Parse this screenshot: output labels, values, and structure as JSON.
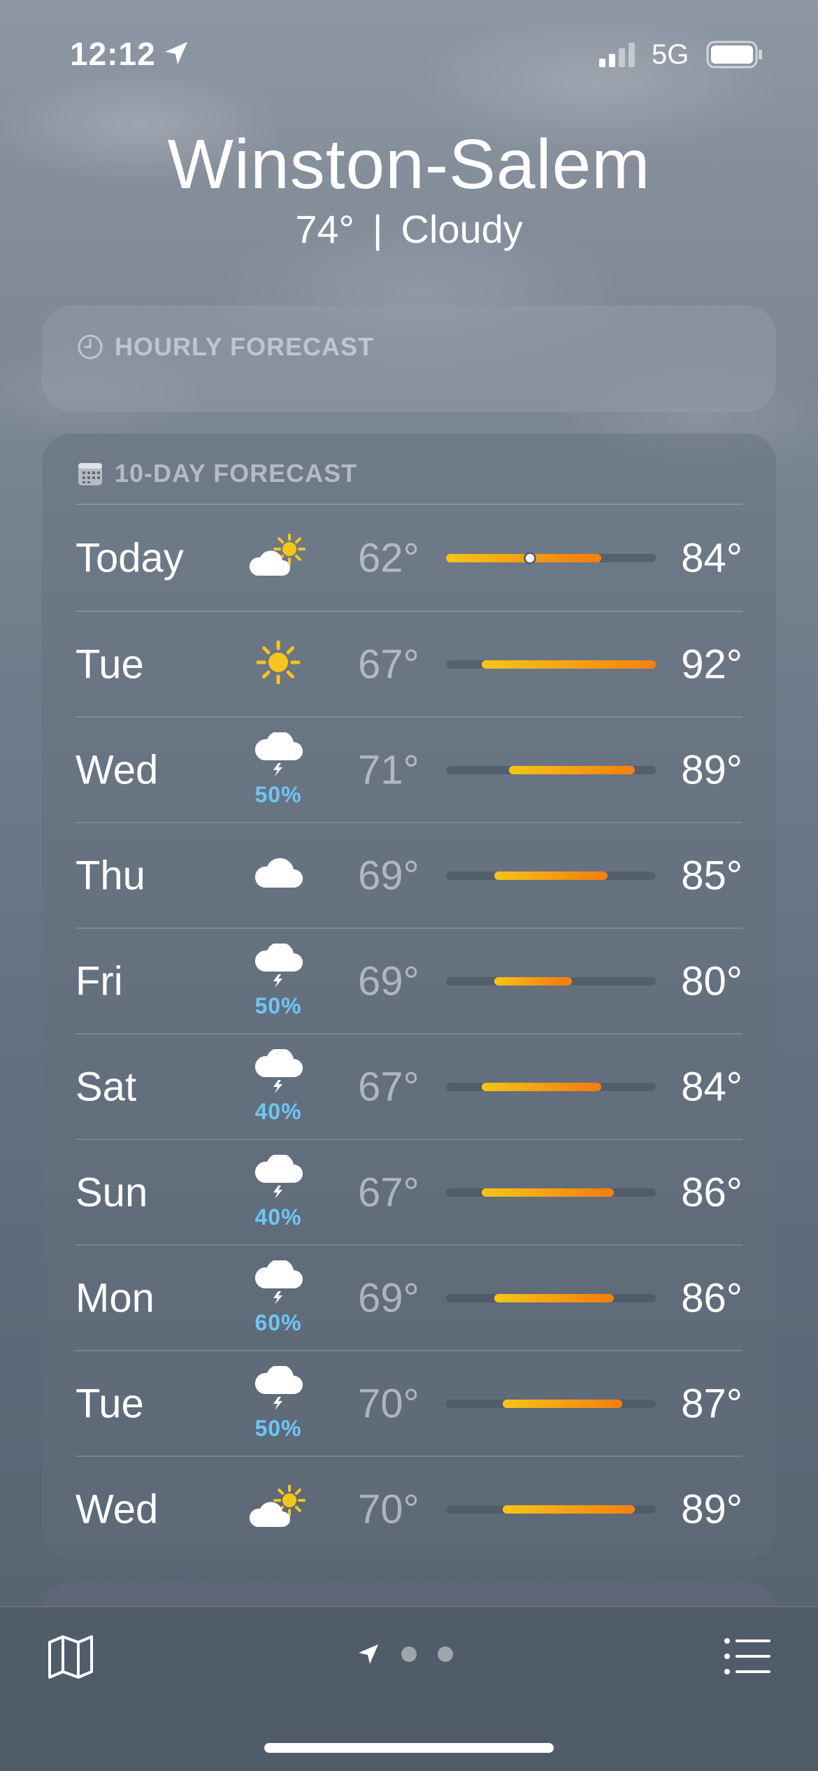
{
  "status_bar": {
    "time": "12:12",
    "network": "5G",
    "icons": [
      "location-arrow-icon",
      "signal-icon",
      "battery-icon"
    ]
  },
  "header": {
    "city": "Winston-Salem",
    "temperature": "74°",
    "separator": "|",
    "condition": "Cloudy"
  },
  "hourly": {
    "title": "HOURLY FORECAST",
    "icon": "clock-icon"
  },
  "ten_day": {
    "title": "10-DAY FORECAST",
    "icon": "calendar-icon",
    "days": [
      {
        "day": "Today",
        "icon": "partly-sunny-icon",
        "precip": "",
        "low": "62°",
        "high": "84°",
        "range_start": 0.0,
        "range_end": 0.74,
        "current": 0.4
      },
      {
        "day": "Tue",
        "icon": "sun-icon",
        "precip": "",
        "low": "67°",
        "high": "92°",
        "range_start": 0.17,
        "range_end": 1.0
      },
      {
        "day": "Wed",
        "icon": "thunderstorm-icon",
        "precip": "50%",
        "low": "71°",
        "high": "89°",
        "range_start": 0.3,
        "range_end": 0.9
      },
      {
        "day": "Thu",
        "icon": "cloud-icon",
        "precip": "",
        "low": "69°",
        "high": "85°",
        "range_start": 0.23,
        "range_end": 0.77
      },
      {
        "day": "Fri",
        "icon": "thunderstorm-icon",
        "precip": "50%",
        "low": "69°",
        "high": "80°",
        "range_start": 0.23,
        "range_end": 0.6
      },
      {
        "day": "Sat",
        "icon": "thunderstorm-icon",
        "precip": "40%",
        "low": "67°",
        "high": "84°",
        "range_start": 0.17,
        "range_end": 0.74
      },
      {
        "day": "Sun",
        "icon": "thunderstorm-icon",
        "precip": "40%",
        "low": "67°",
        "high": "86°",
        "range_start": 0.17,
        "range_end": 0.8
      },
      {
        "day": "Mon",
        "icon": "thunderstorm-icon",
        "precip": "60%",
        "low": "69°",
        "high": "86°",
        "range_start": 0.23,
        "range_end": 0.8
      },
      {
        "day": "Tue",
        "icon": "thunderstorm-icon",
        "precip": "50%",
        "low": "70°",
        "high": "87°",
        "range_start": 0.27,
        "range_end": 0.84
      },
      {
        "day": "Wed",
        "icon": "partly-sunny-icon",
        "precip": "",
        "low": "70°",
        "high": "89°",
        "range_start": 0.27,
        "range_end": 0.9
      }
    ]
  },
  "colors": {
    "precip": "#6cc7f5",
    "bar_cool": "#f5c518",
    "bar_warm": "#f5820f",
    "sun": "#f7c51b",
    "toolbar": "#515c6b"
  },
  "toolbar": {
    "icons": [
      "map-icon",
      "location-arrow-icon",
      "list-icon"
    ],
    "page_count": 3
  }
}
